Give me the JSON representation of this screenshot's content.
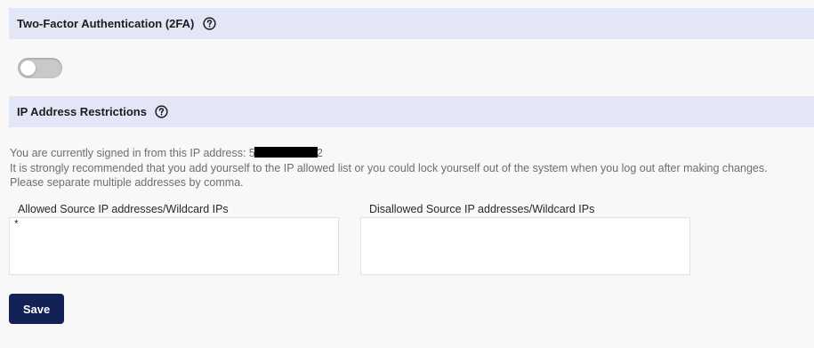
{
  "two_factor": {
    "title": "Two-Factor Authentication (2FA)",
    "enabled": false
  },
  "ip_restrictions": {
    "title": "IP Address Restrictions",
    "signed_in_prefix": "You are currently signed in from this IP address: ",
    "ip_visible_start": "5",
    "ip_visible_end": "2",
    "recommendation": "It is strongly recommended that you add yourself to the IP allowed list or you could lock yourself out of the system when you log out after making changes.",
    "separator_hint": "Please separate multiple addresses by comma.",
    "allowed_label": "Allowed Source IP addresses/Wildcard IPs",
    "allowed_value": "*",
    "disallowed_label": "Disallowed Source IP addresses/Wildcard IPs",
    "disallowed_value": ""
  },
  "actions": {
    "save_label": "Save"
  },
  "colors": {
    "header_bg": "#e3e6f6",
    "primary_button": "#142157"
  },
  "icons": {
    "help": "question-circle-icon"
  }
}
